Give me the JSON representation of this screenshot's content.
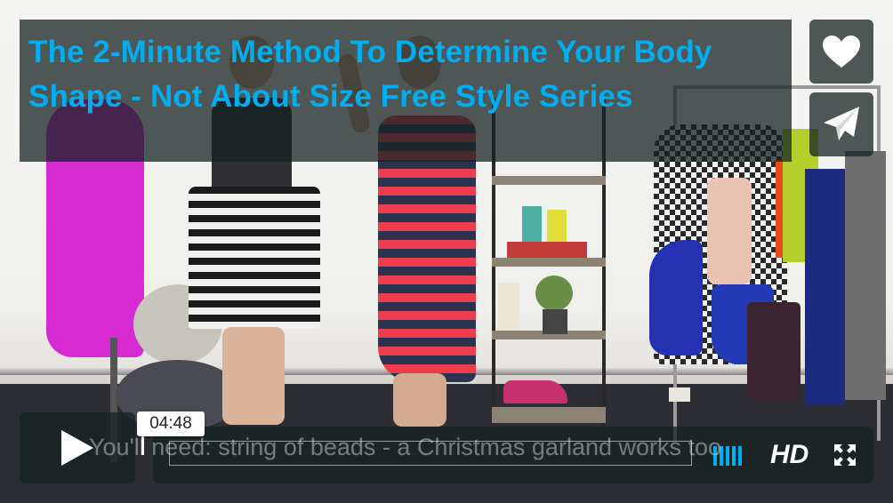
{
  "video": {
    "title": "The 2-Minute Method To Determine Your Body Shape - Not About Size Free Style Series",
    "caption_text": "You'll need: string of beads - a Christmas garland works too",
    "timecode": "04:48",
    "quality_label": "HD",
    "volume_level_bars": 5,
    "accent_color": "#00adef"
  },
  "icons": {
    "like": "heart-icon",
    "share": "paper-plane-icon",
    "play": "play-icon",
    "volume": "volume-bars-icon",
    "fullscreen": "fullscreen-icon"
  }
}
